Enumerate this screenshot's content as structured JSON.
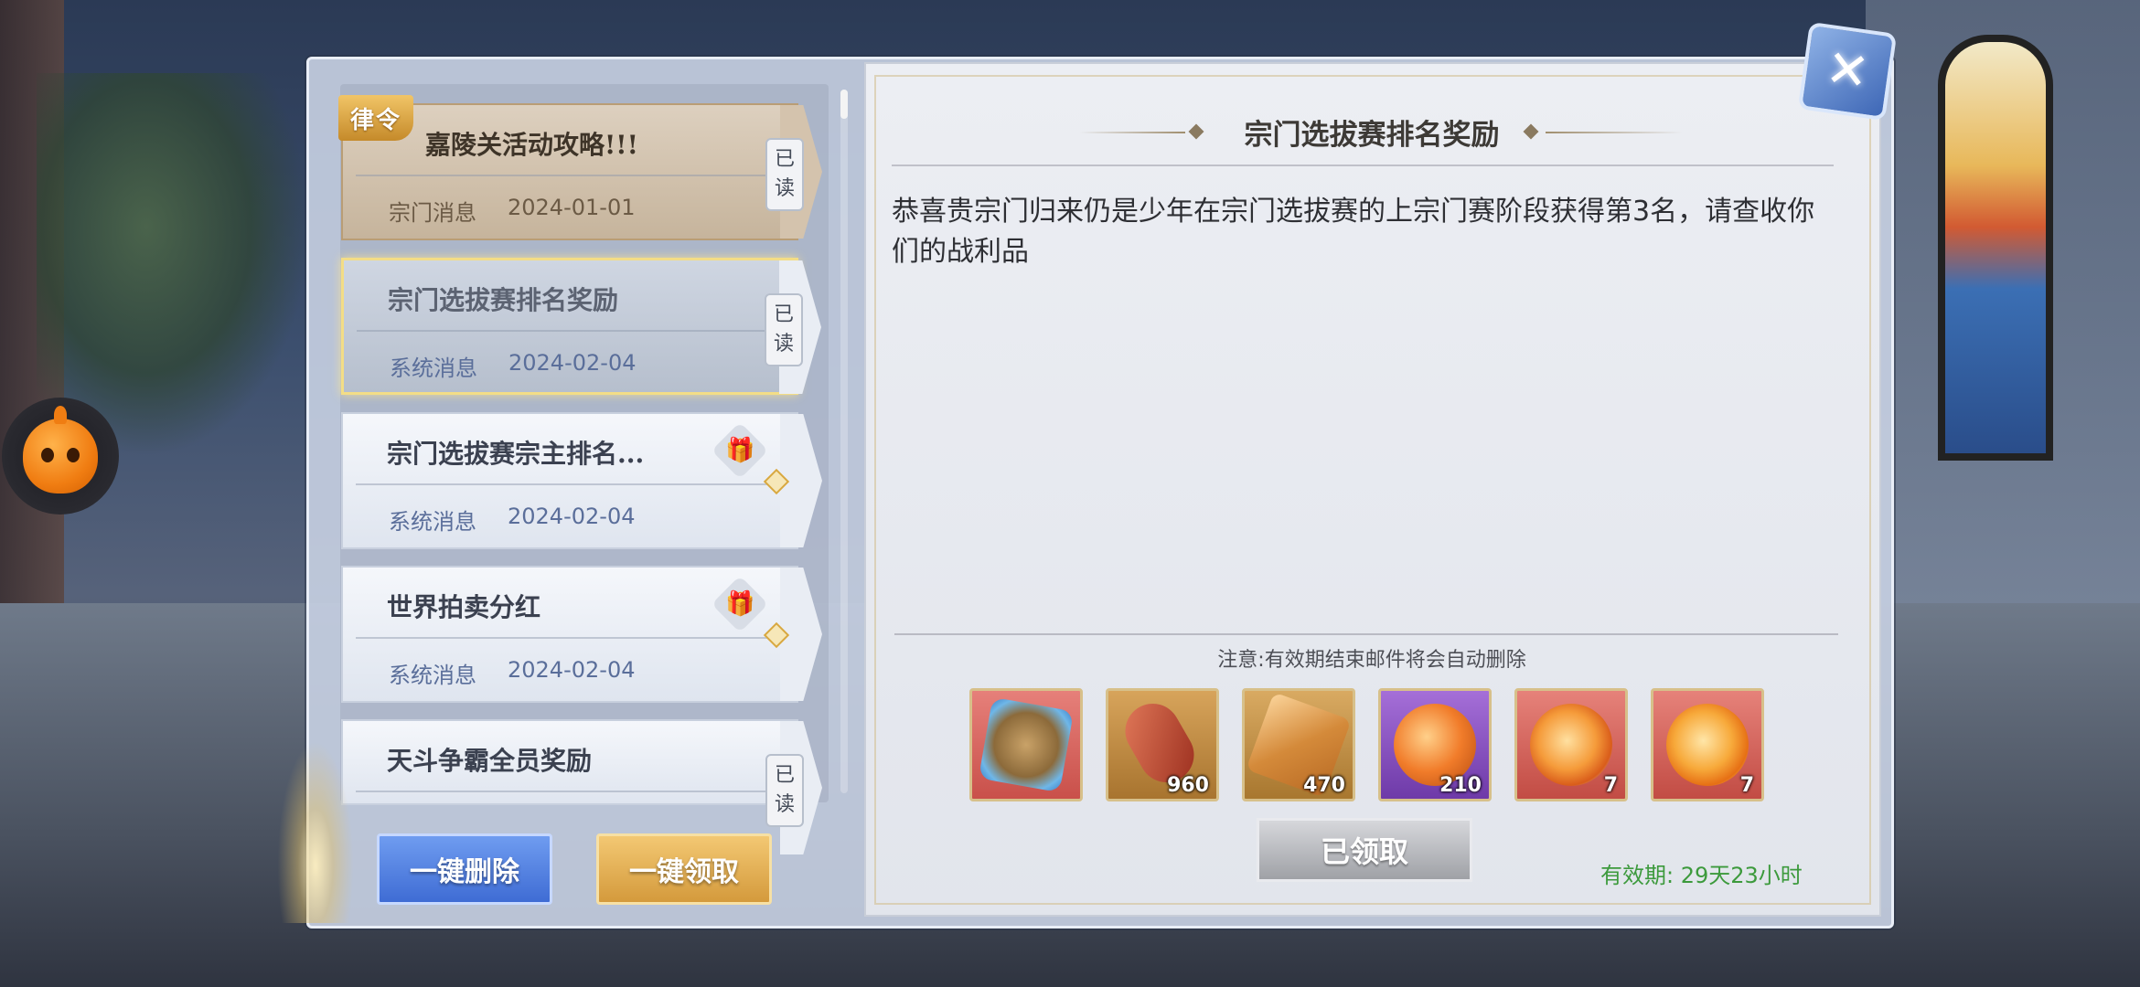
{
  "mail_list": {
    "ribbon": "律令",
    "items": [
      {
        "title": "嘉陵关活动攻略!!!",
        "sender": "宗门消息",
        "date": "2024-01-01",
        "status": "已读"
      },
      {
        "title": "宗门选拔赛排名奖励",
        "sender": "系统消息",
        "date": "2024-02-04",
        "status": "已读"
      },
      {
        "title": "宗门选拔赛宗主排名...",
        "sender": "系统消息",
        "date": "2024-02-04",
        "status": ""
      },
      {
        "title": "世界拍卖分红",
        "sender": "系统消息",
        "date": "2024-02-04",
        "status": ""
      },
      {
        "title": "天斗争霸全员奖励",
        "sender": "",
        "date": "",
        "status": "已读"
      }
    ]
  },
  "buttons": {
    "delete_all": "一键删除",
    "claim_all": "一键领取",
    "claimed": "已领取"
  },
  "detail": {
    "title": "宗门选拔赛排名奖励",
    "body": "恭喜贵宗门归来仍是少年在宗门选拔赛的上宗门赛阶段获得第3名，请查收你们的战利品",
    "notice": "注意:有效期结束邮件将会自动删除",
    "validity_label": "有效期:",
    "validity_value": "29天23小时"
  },
  "rewards": [
    {
      "icon": "frame-icon",
      "qty": ""
    },
    {
      "icon": "sausage-icon",
      "qty": "960"
    },
    {
      "icon": "ore-icon",
      "qty": "470"
    },
    {
      "icon": "orb-purple-icon",
      "qty": "210"
    },
    {
      "icon": "orb-silver-icon",
      "qty": "7"
    },
    {
      "icon": "orb-gold-icon",
      "qty": "7"
    }
  ],
  "colors": {
    "validity": "#3c9a3c",
    "delete_button": "#4f7fe0",
    "claim_button": "#e2ae52",
    "selected_border": "#f3dd86"
  }
}
